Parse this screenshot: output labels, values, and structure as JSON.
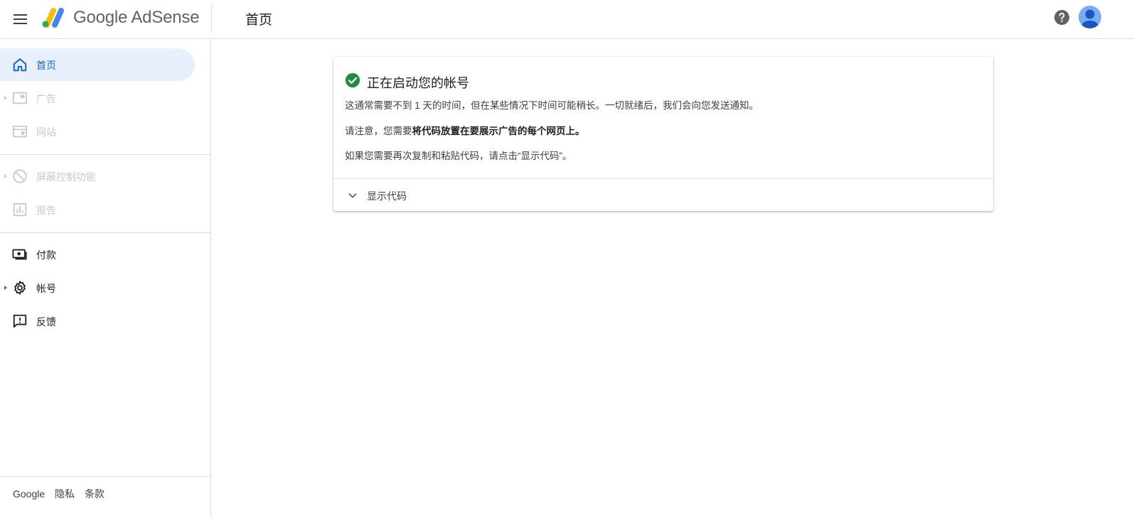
{
  "header": {
    "brand_google": "Google",
    "brand_product": "AdSense",
    "page_title": "首页"
  },
  "sidebar": {
    "items": [
      {
        "label": "首页",
        "icon": "home-icon",
        "state": "active"
      },
      {
        "label": "广告",
        "icon": "ads-icon",
        "state": "disabled"
      },
      {
        "label": "网站",
        "icon": "sites-icon",
        "state": "disabled"
      },
      {
        "label": "屏蔽控制功能",
        "icon": "block-icon",
        "state": "disabled"
      },
      {
        "label": "报告",
        "icon": "reports-icon",
        "state": "disabled"
      },
      {
        "label": "付款",
        "icon": "payments-icon",
        "state": "enabled"
      },
      {
        "label": "帐号",
        "icon": "gear-icon",
        "state": "enabled"
      },
      {
        "label": "反馈",
        "icon": "feedback-icon",
        "state": "enabled"
      }
    ],
    "footer": {
      "google": "Google",
      "privacy": "隐私",
      "terms": "条款"
    }
  },
  "card": {
    "title": "正在启动您的帐号",
    "p1": "这通常需要不到 1 天的时间，但在某些情况下时间可能稍长。一切就绪后，我们会向您发送通知。",
    "p2_prefix": "请注意，您需要",
    "p2_bold": "将代码放置在要展示广告的每个网页上。",
    "p3": "如果您需要再次复制和粘贴代码，请点击“显示代码”。",
    "show_code_label": "显示代码"
  },
  "colors": {
    "accent": "#1967d2",
    "active_bg": "#e8f0fe",
    "success": "#1e8e3e",
    "disabled_text": "#c8c9cc"
  }
}
